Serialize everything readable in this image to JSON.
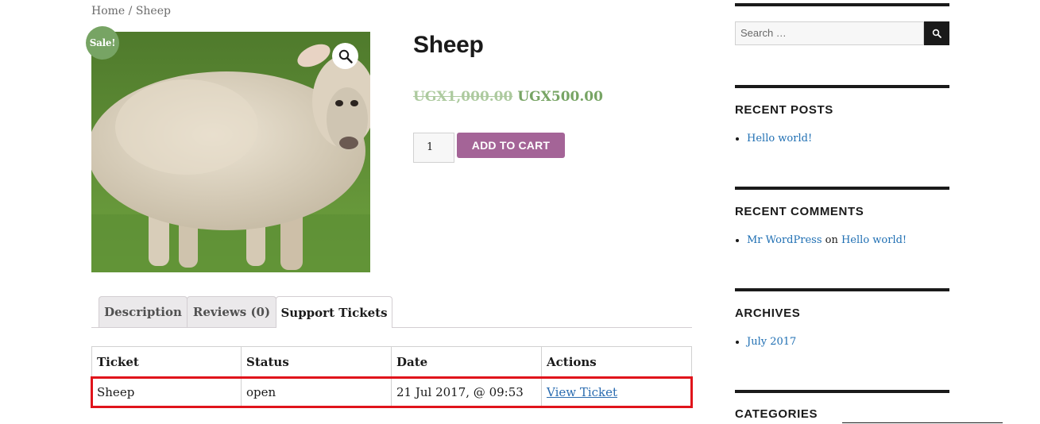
{
  "breadcrumb": {
    "home": "Home",
    "separator": " / ",
    "current": "Sheep"
  },
  "product": {
    "sale_badge": "Sale!",
    "title": "Sheep",
    "price_old": "UGX1,000.00",
    "price_new": "UGX500.00",
    "quantity": "1",
    "add_to_cart": "ADD TO CART",
    "zoom_icon": "magnifier-icon"
  },
  "tabs": [
    {
      "label": "Description"
    },
    {
      "label": "Reviews (0)"
    },
    {
      "label": "Support Tickets"
    }
  ],
  "tickets": {
    "headers": [
      "Ticket",
      "Status",
      "Date",
      "Actions"
    ],
    "rows": [
      {
        "ticket": "Sheep",
        "status": "open",
        "date": "21 Jul 2017, @ 09:53",
        "action": "View Ticket"
      }
    ]
  },
  "sidebar": {
    "search_placeholder": "Search …",
    "search_icon": "search-icon",
    "recent_posts": {
      "title": "RECENT POSTS",
      "items": [
        "Hello world!"
      ]
    },
    "recent_comments": {
      "title": "RECENT COMMENTS",
      "author": "Mr WordPress",
      "on": " on ",
      "post": "Hello world!"
    },
    "archives": {
      "title": "ARCHIVES",
      "items": [
        "July 2017"
      ]
    },
    "categories": {
      "title": "CATEGORIES"
    }
  },
  "colors": {
    "sale": "#77a464",
    "cart_button": "#a46497",
    "link": "#1f6fb3",
    "highlight": "#e0141b"
  }
}
